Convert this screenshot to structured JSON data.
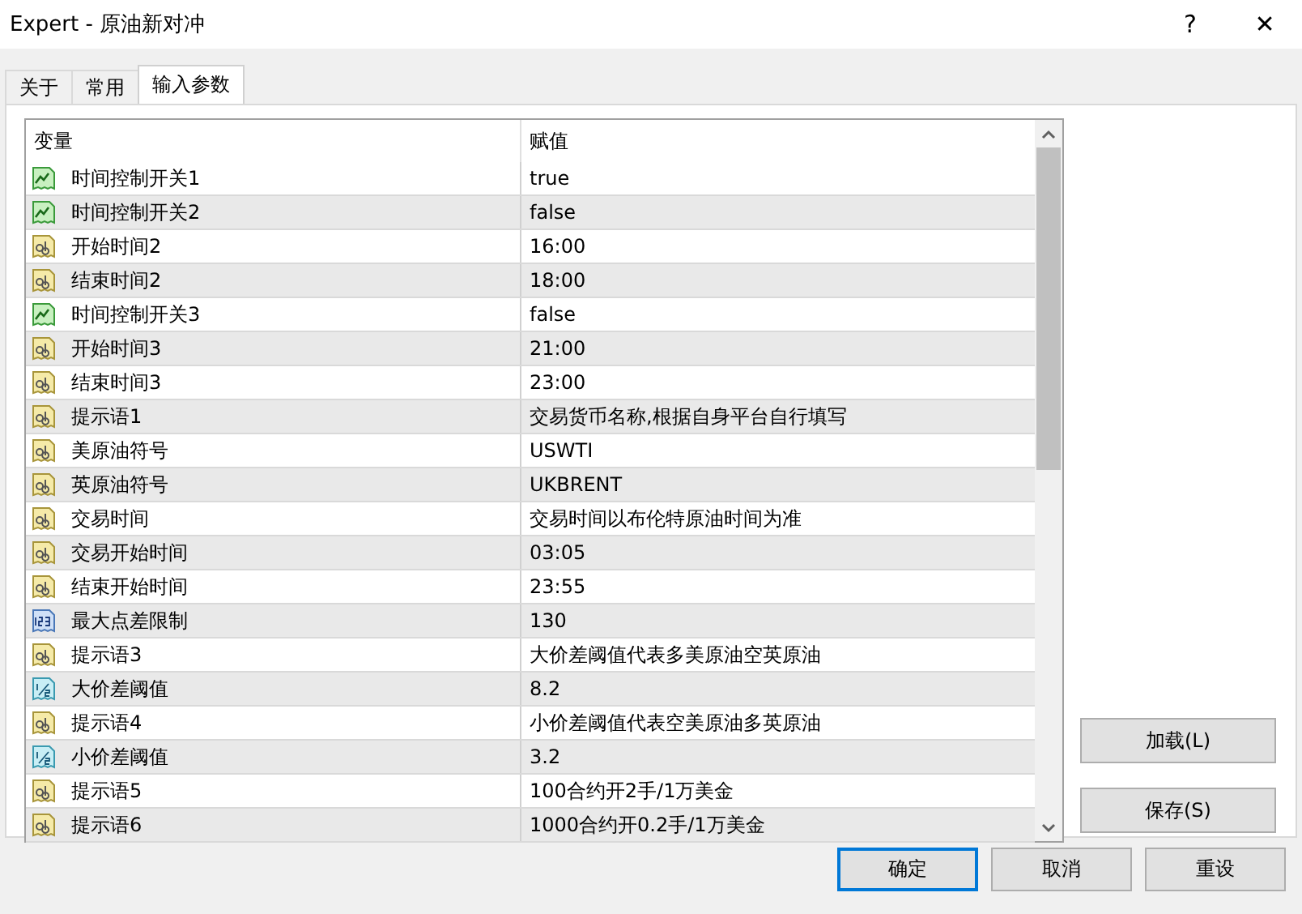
{
  "window": {
    "title": "Expert - 原油新对冲",
    "help": "?",
    "close": "✕"
  },
  "tabs": [
    {
      "label": "关于",
      "selected": false
    },
    {
      "label": "常用",
      "selected": false
    },
    {
      "label": "输入参数",
      "selected": true
    }
  ],
  "table": {
    "columns": [
      "变量",
      "赋值"
    ],
    "rows": [
      {
        "kind": "bool",
        "name": "时间控制开关1",
        "value": "true"
      },
      {
        "kind": "bool",
        "name": "时间控制开关2",
        "value": "false"
      },
      {
        "kind": "string",
        "name": "开始时间2",
        "value": "16:00"
      },
      {
        "kind": "string",
        "name": "结束时间2",
        "value": "18:00"
      },
      {
        "kind": "bool",
        "name": "时间控制开关3",
        "value": "false"
      },
      {
        "kind": "string",
        "name": "开始时间3",
        "value": "21:00"
      },
      {
        "kind": "string",
        "name": "结束时间3",
        "value": "23:00"
      },
      {
        "kind": "string",
        "name": "提示语1",
        "value": "交易货币名称,根据自身平台自行填写"
      },
      {
        "kind": "string",
        "name": "美原油符号",
        "value": "USWTI"
      },
      {
        "kind": "string",
        "name": "英原油符号",
        "value": "UKBRENT"
      },
      {
        "kind": "string",
        "name": "交易时间",
        "value": "交易时间以布伦特原油时间为准"
      },
      {
        "kind": "string",
        "name": "交易开始时间",
        "value": "03:05"
      },
      {
        "kind": "string",
        "name": "结束开始时间",
        "value": "23:55"
      },
      {
        "kind": "int",
        "name": "最大点差限制",
        "value": "130"
      },
      {
        "kind": "string",
        "name": "提示语3",
        "value": "大价差阈值代表多美原油空英原油"
      },
      {
        "kind": "double",
        "name": "大价差阈值",
        "value": "8.2"
      },
      {
        "kind": "string",
        "name": "提示语4",
        "value": "小价差阈值代表空美原油多英原油"
      },
      {
        "kind": "double",
        "name": "小价差阈值",
        "value": "3.2"
      },
      {
        "kind": "string",
        "name": "提示语5",
        "value": "100合约开2手/1万美金"
      },
      {
        "kind": "string",
        "name": "提示语6",
        "value": "1000合约开0.2手/1万美金"
      }
    ]
  },
  "side_buttons": [
    "加载(L)",
    "保存(S)"
  ],
  "buttons": [
    {
      "label": "确定",
      "default": true
    },
    {
      "label": "取消",
      "default": false
    },
    {
      "label": "重设",
      "default": false
    }
  ]
}
